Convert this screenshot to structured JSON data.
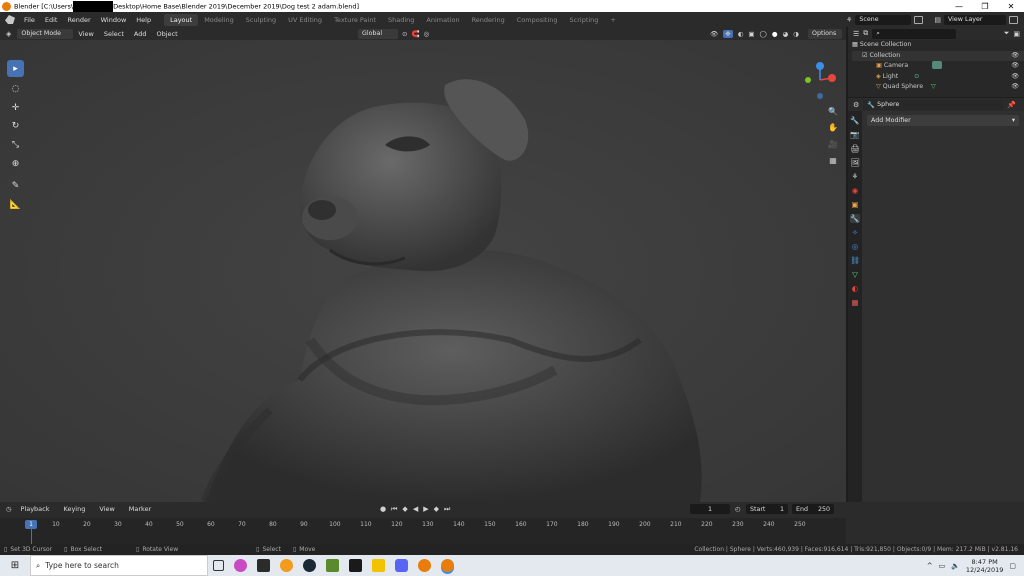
{
  "window": {
    "title_start": "Blender [C:\\Users\\",
    "title_end": "Desktop\\Home Base\\Blender 2019\\December 2019\\Dog test 2 adam.blend]",
    "minimize_icon": "minimize-icon",
    "maximize_icon": "maximize-icon",
    "close_icon": "close-icon",
    "minimize_glyph": "—",
    "maximize_glyph": "❐",
    "close_glyph": "✕"
  },
  "menu": [
    "File",
    "Edit",
    "Render",
    "Window",
    "Help"
  ],
  "workspaces": [
    "Layout",
    "Modeling",
    "Sculpting",
    "UV Editing",
    "Texture Paint",
    "Shading",
    "Animation",
    "Rendering",
    "Compositing",
    "Scripting"
  ],
  "active_workspace": "Layout",
  "add_workspace": "+",
  "scene": {
    "label": "Scene",
    "view_layer": "View Layer"
  },
  "viewport_header": {
    "mode": "Object Mode",
    "menus": [
      "View",
      "Select",
      "Add",
      "Object"
    ],
    "orientation": "Global",
    "options": "Options"
  },
  "outliner": {
    "search_placeholder": "",
    "scene_collection": "Scene Collection",
    "collection": "Collection",
    "items": [
      {
        "name": "Camera",
        "color": "#9fa8b3"
      },
      {
        "name": "Light",
        "color": "#9fa8b3"
      },
      {
        "name": "Quad Sphere",
        "color": "#9fa8b3"
      }
    ]
  },
  "properties": {
    "object_name": "Sphere",
    "add_modifier": "Add Modifier"
  },
  "timeline": {
    "menus": [
      "Playback",
      "Keying",
      "View",
      "Marker"
    ],
    "current_frame": "1",
    "start_label": "Start",
    "start": "1",
    "end_label": "End",
    "end": "250",
    "ticks": [
      "1",
      "10",
      "20",
      "30",
      "40",
      "50",
      "60",
      "70",
      "80",
      "90",
      "100",
      "110",
      "120",
      "130",
      "140",
      "150",
      "160",
      "170",
      "180",
      "190",
      "200",
      "210",
      "220",
      "230",
      "240",
      "250"
    ]
  },
  "statusbar": {
    "left": [
      "Set 3D Cursor",
      "Box Select",
      "Rotate View",
      "Select",
      "Move"
    ],
    "right": "Collection | Sphere | Verts:460,939 | Faces:916,614 | Tris:921,850 | Objects:0/9 | Mem: 217.2 MiB | v2.81.16"
  },
  "taskbar": {
    "search_placeholder": "Type here to search",
    "time": "8:47 PM",
    "date": "12/24/2019"
  },
  "colors": {
    "accent": "#4772b3",
    "blender_orange": "#e87d0d",
    "axis_x": "#e8453c",
    "axis_y": "#7fc41c",
    "axis_z": "#3d8ee8"
  }
}
